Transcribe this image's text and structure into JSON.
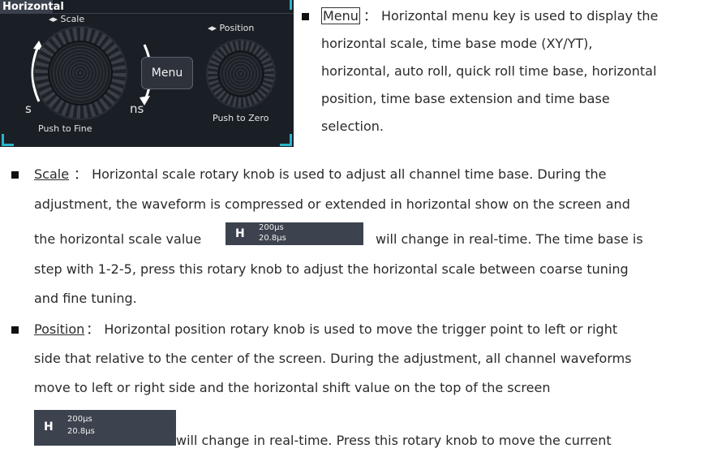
{
  "panel": {
    "title": "Horizontal",
    "scale_label": "◂▸ Scale",
    "position_label": "◂▸ Position",
    "menu_button": "Menu",
    "s_label": "s",
    "ns_label": "ns",
    "push_fine": "Push to Fine",
    "push_zero": "Push to Zero"
  },
  "menu_item": {
    "key": "Menu",
    "sep": "：",
    "line1": "Horizontal menu key is used to display the",
    "line2": "horizontal scale, time base mode (XY/YT),",
    "line3": "horizontal, auto roll, quick roll time base, horizontal",
    "line4": "position, time base extension and time base",
    "line5": "selection."
  },
  "scale_item": {
    "key": "Scale",
    "sep": "：",
    "line1": "Horizontal scale rotary knob is used to adjust all channel time base. During the",
    "line2": "adjustment, the waveform is compressed or extended in horizontal show on the screen and",
    "line3a": "the horizontal scale value",
    "line3b": "will change in real-time. The time base is",
    "line4": "step with 1-2-5, press this rotary knob to adjust the horizontal scale between coarse tuning",
    "line5": "and fine tuning."
  },
  "position_item": {
    "key": "Position",
    "sep": "：",
    "line1": "Horizontal position rotary knob is used to move the trigger point to left or right",
    "line2": "side that relative to the center of the screen. During the adjustment, all channel waveforms",
    "line3": "move to left or right side and the horizontal shift value on the top of the screen",
    "line4b": "will change in real-time. Press this rotary knob to move the current"
  },
  "h_indicator": {
    "h": "H",
    "v1": "200µs",
    "v2": "20.8µs"
  }
}
